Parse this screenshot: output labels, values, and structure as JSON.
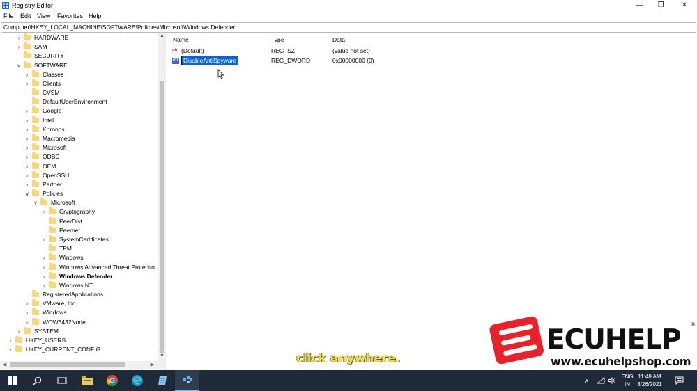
{
  "window": {
    "title": "Registry Editor",
    "minimize_glyph": "—",
    "restore_glyph": "❐",
    "close_glyph": "✕"
  },
  "menu": {
    "items": [
      "File",
      "Edit",
      "View",
      "Favorites",
      "Help"
    ]
  },
  "address": {
    "path": "Computer\\HKEY_LOCAL_MACHINE\\SOFTWARE\\Policies\\Microsoft\\Windows Defender"
  },
  "tree": {
    "items": [
      {
        "label": "HARDWARE",
        "expander": "›"
      },
      {
        "label": "SAM",
        "expander": "›"
      },
      {
        "label": "SECURITY",
        "expander": ""
      },
      {
        "label": "SOFTWARE",
        "expander": "∨"
      },
      {
        "label": "Classes",
        "expander": "›"
      },
      {
        "label": "Clients",
        "expander": "›"
      },
      {
        "label": "CVSM",
        "expander": ""
      },
      {
        "label": "DefaultUserEnvironment",
        "expander": ""
      },
      {
        "label": "Google",
        "expander": "›"
      },
      {
        "label": "Intel",
        "expander": "›"
      },
      {
        "label": "Khronos",
        "expander": "›"
      },
      {
        "label": "Macromedia",
        "expander": "›"
      },
      {
        "label": "Microsoft",
        "expander": "›"
      },
      {
        "label": "ODBC",
        "expander": "›"
      },
      {
        "label": "OEM",
        "expander": "›"
      },
      {
        "label": "OpenSSH",
        "expander": "›"
      },
      {
        "label": "Partner",
        "expander": "›"
      },
      {
        "label": "Policies",
        "expander": "∨"
      },
      {
        "label": "Microsoft",
        "expander": "∨"
      },
      {
        "label": "Cryptography",
        "expander": "›"
      },
      {
        "label": "PeerDist",
        "expander": ""
      },
      {
        "label": "Peernet",
        "expander": ""
      },
      {
        "label": "SystemCertificates",
        "expander": "›"
      },
      {
        "label": "TPM",
        "expander": ""
      },
      {
        "label": "Windows",
        "expander": "›"
      },
      {
        "label": "Windows Advanced Threat Protectio",
        "expander": "›"
      },
      {
        "label": "Windows Defender",
        "expander": "›"
      },
      {
        "label": "Windows NT",
        "expander": "›"
      },
      {
        "label": "RegisteredApplications",
        "expander": ""
      },
      {
        "label": "VMware, Inc.",
        "expander": "›"
      },
      {
        "label": "Windows",
        "expander": "›"
      },
      {
        "label": "WOW6432Node",
        "expander": "›"
      },
      {
        "label": "SYSTEM",
        "expander": "›"
      },
      {
        "label": "HKEY_USERS",
        "expander": "›"
      },
      {
        "label": "HKEY_CURRENT_CONFIG",
        "expander": "›"
      }
    ],
    "selected_label": "Windows Defender"
  },
  "values": {
    "columns": [
      "Name",
      "Type",
      "Data"
    ],
    "rows": [
      {
        "icon": "string-value-icon",
        "icon_text": "ab",
        "name": "(Default)",
        "type": "REG_SZ",
        "data": "(value not set)"
      },
      {
        "icon": "dword-value-icon",
        "icon_text": "011",
        "name": "DisableAntiSpyware",
        "type": "REG_DWORD",
        "data": "0x00000000 (0)"
      }
    ]
  },
  "caption": "click anywhere.",
  "watermark": {
    "brand": "ECUHELP",
    "reg_mark": "®",
    "url": "www.ecuhelpshop.com",
    "brand_color": "#e8222a"
  },
  "taskbar": {
    "lang_top": "ENG",
    "lang_bottom": "IN",
    "time": "11:48 AM",
    "date": "8/26/2021",
    "accent": "#76b9ed"
  }
}
